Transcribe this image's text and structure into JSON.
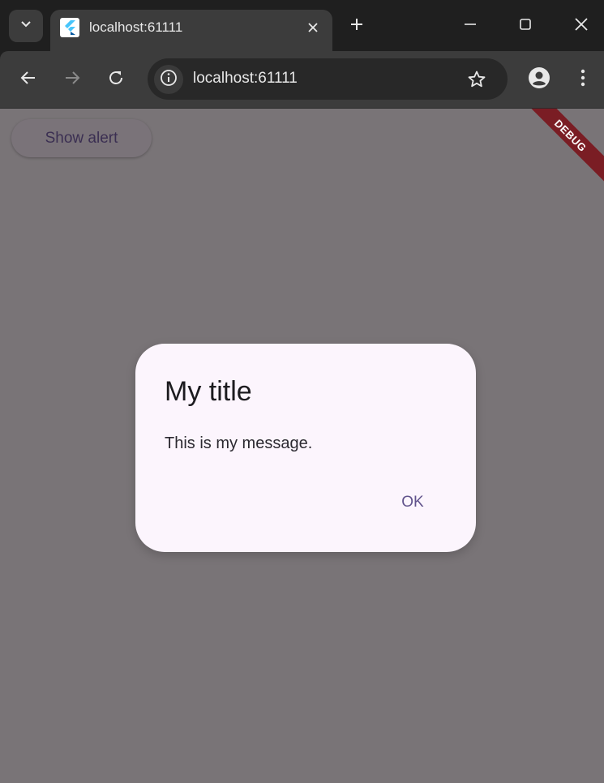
{
  "browser": {
    "tab": {
      "title": "localhost:61111"
    },
    "address_bar": {
      "url": "localhost:61111"
    },
    "icons": {
      "tab_search": "chevron-down-icon",
      "favicon": "flutter-logo-icon",
      "close_tab": "close-icon",
      "new_tab": "plus-icon",
      "minimize": "minimize-icon",
      "maximize": "maximize-icon",
      "close_window": "close-icon",
      "back": "arrow-left-icon",
      "forward": "arrow-right-icon",
      "reload": "reload-icon",
      "site_info": "info-icon",
      "bookmark": "star-icon",
      "profile": "person-icon",
      "menu": "more-vert-icon"
    }
  },
  "app": {
    "show_alert_label": "Show alert",
    "debug_banner": "DEBUG",
    "dialog": {
      "title": "My title",
      "message": "This is my message.",
      "ok_label": "OK"
    }
  },
  "colors": {
    "page_scrim": "#797477",
    "dialog_bg": "#fcf5fd",
    "accent": "#61538c",
    "debug_banner": "#7a1d24"
  }
}
